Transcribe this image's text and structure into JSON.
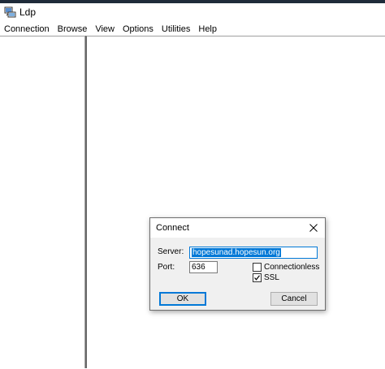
{
  "window": {
    "title": "Ldp",
    "icon": "ldp-app-icon",
    "menu": [
      "Connection",
      "Browse",
      "View",
      "Options",
      "Utilities",
      "Help"
    ]
  },
  "dialog": {
    "title": "Connect",
    "close_icon": "close-icon",
    "server_label": "Server:",
    "server_value": "hopesunad.hopesun.org",
    "port_label": "Port:",
    "port_value": "636",
    "connectionless_label": "Connectionless",
    "connectionless_checked": false,
    "ssl_label": "SSL",
    "ssl_checked": true,
    "ok_label": "OK",
    "cancel_label": "Cancel"
  }
}
